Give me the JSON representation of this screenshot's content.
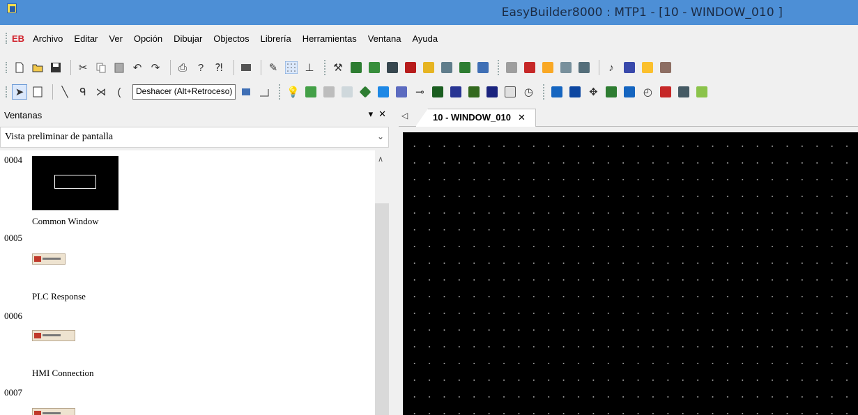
{
  "window": {
    "title": "EasyBuilder8000 : MTP1 - [10 - WINDOW_010 ]"
  },
  "menubar": {
    "logo": "EB",
    "items": [
      "Archivo",
      "Editar",
      "Ver",
      "Opción",
      "Dibujar",
      "Objectos",
      "Librería",
      "Herramientas",
      "Ventana",
      "Ayuda"
    ]
  },
  "toolbar1": {
    "icons": [
      "new-file-icon",
      "open-folder-icon",
      "save-icon",
      "cut-icon",
      "copy-icon",
      "paste-icon",
      "undo-icon",
      "redo-icon",
      "print-icon",
      "help-icon",
      "context-help-icon",
      "find-icon",
      "pen-icon",
      "grid-icon",
      "align-icon",
      "tools-icon",
      "compile-icon",
      "simulate-icon",
      "download-icon",
      "cf-icon",
      "draw-icon",
      "picture-icon",
      "table-icon",
      "address-icon",
      "transfer-icon",
      "window-icon",
      "library-icon",
      "list-icon",
      "list2-icon",
      "music-icon",
      "screen-icon",
      "message-icon",
      "edit-icon"
    ]
  },
  "toolbar2": {
    "tooltip": "Deshacer (Alt+Retroceso)",
    "icons": [
      "select-arrow-icon",
      "properties-icon",
      "line-icon",
      "polyline-icon",
      "arc-cross-icon",
      "arc-icon",
      "rect-icon",
      "frame-icon",
      "bulb-icon",
      "bit-lamp-icon",
      "word-lamp-icon",
      "number-icon",
      "shape-icon",
      "monitor-icon",
      "panel-icon",
      "slider-icon",
      "numeric-display-icon",
      "numeric-input-icon",
      "ascii-display-icon",
      "ascii-input-icon",
      "function-key-icon",
      "clock-icon",
      "keypad-icon",
      "numpad-icon",
      "move-icon",
      "network-icon",
      "bar-chart-icon",
      "meter-icon",
      "trend-icon",
      "table2-icon",
      "image-icon"
    ]
  },
  "panel": {
    "title": "Ventanas",
    "pin": "▾",
    "close": "✕",
    "selector_value": "Vista preliminar de pantalla",
    "items": [
      {
        "id": "0004",
        "name": "Common Window"
      },
      {
        "id": "0005",
        "name": "PLC Response"
      },
      {
        "id": "0006",
        "name": "HMI Connection"
      },
      {
        "id": "0007",
        "name": ""
      }
    ]
  },
  "editor": {
    "tab_label": "10 - WINDOW_010",
    "tab_close": "✕",
    "scroll_left": "◁"
  }
}
